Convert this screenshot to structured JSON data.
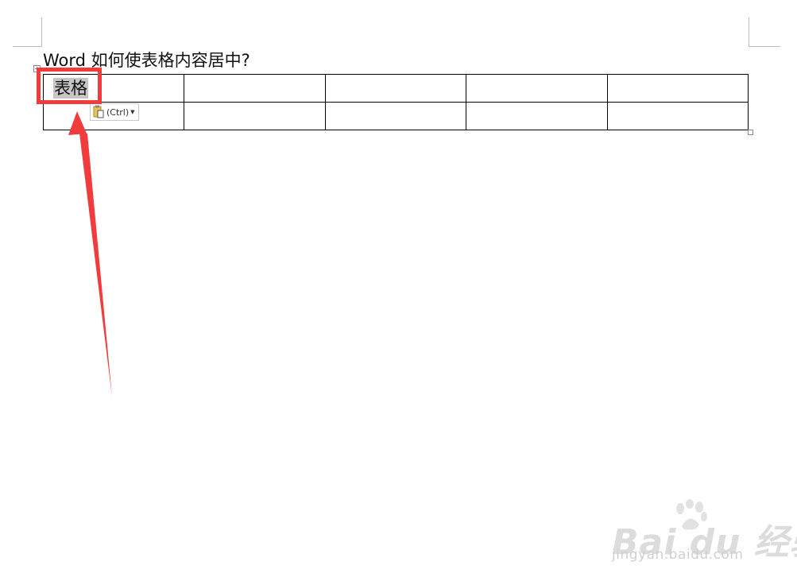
{
  "document": {
    "title": "Word 如何使表格内容居中?"
  },
  "table": {
    "rows": [
      [
        "表格",
        "",
        "",
        "",
        ""
      ],
      [
        "",
        "",
        "",
        "",
        ""
      ]
    ]
  },
  "paste_options": {
    "label": "(Ctrl)",
    "icon": "clipboard-icon"
  },
  "annotation": {
    "color": "#f03c3c"
  },
  "watermark": {
    "brand": "Bai du 经验",
    "url": "jingyan.baidu.com"
  }
}
